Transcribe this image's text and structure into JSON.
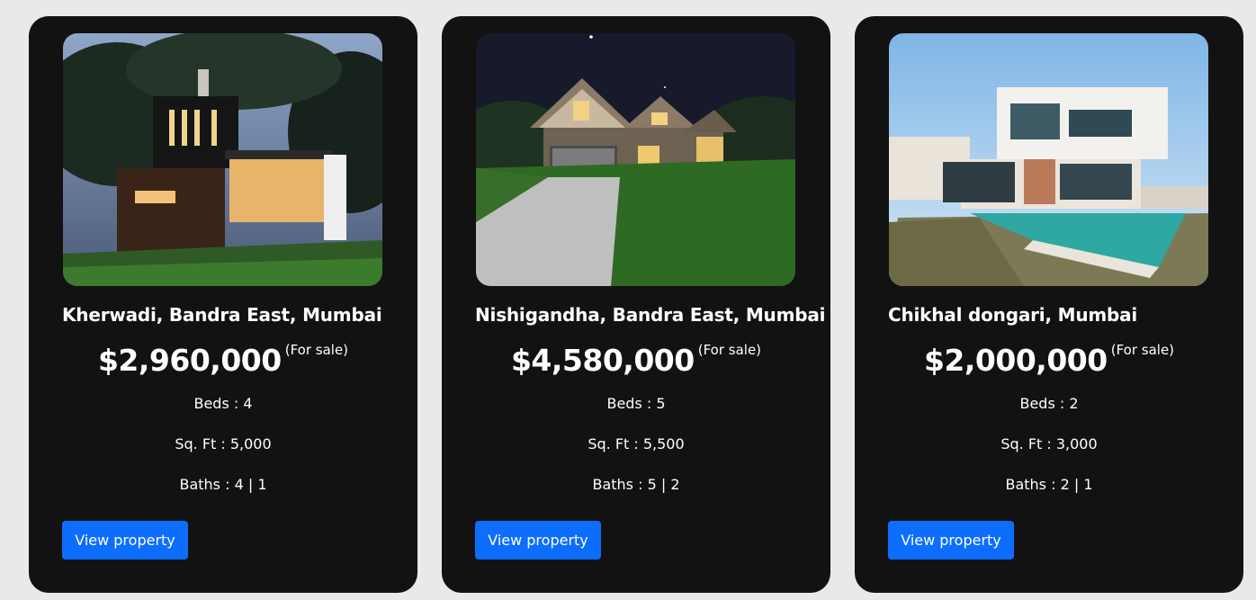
{
  "properties": [
    {
      "image_icon": "house-photo",
      "location": "Kherwadi, Bandra East, Mumbai",
      "price": "$2,960,000",
      "status": "(For sale)",
      "beds": "Beds : 4",
      "sqft": "Sq. Ft : 5,000",
      "baths": "Baths : 4 | 1",
      "button_label": "View property"
    },
    {
      "image_icon": "house-photo",
      "location": "Nishigandha, Bandra East, Mumbai",
      "price": "$4,580,000",
      "status": "(For sale)",
      "beds": "Beds : 5",
      "sqft": "Sq. Ft : 5,500",
      "baths": "Baths : 5 | 2",
      "button_label": "View property"
    },
    {
      "image_icon": "house-photo",
      "location": "Chikhal dongari, Mumbai",
      "price": "$2,000,000",
      "status": "(For sale)",
      "beds": "Beds : 2",
      "sqft": "Sq. Ft : 3,000",
      "baths": "Baths : 2 | 1",
      "button_label": "View property"
    }
  ],
  "colors": {
    "page_background": "#e9e9e9",
    "card_background": "#121212",
    "button_background": "#0d6efd",
    "text": "#ffffff"
  }
}
